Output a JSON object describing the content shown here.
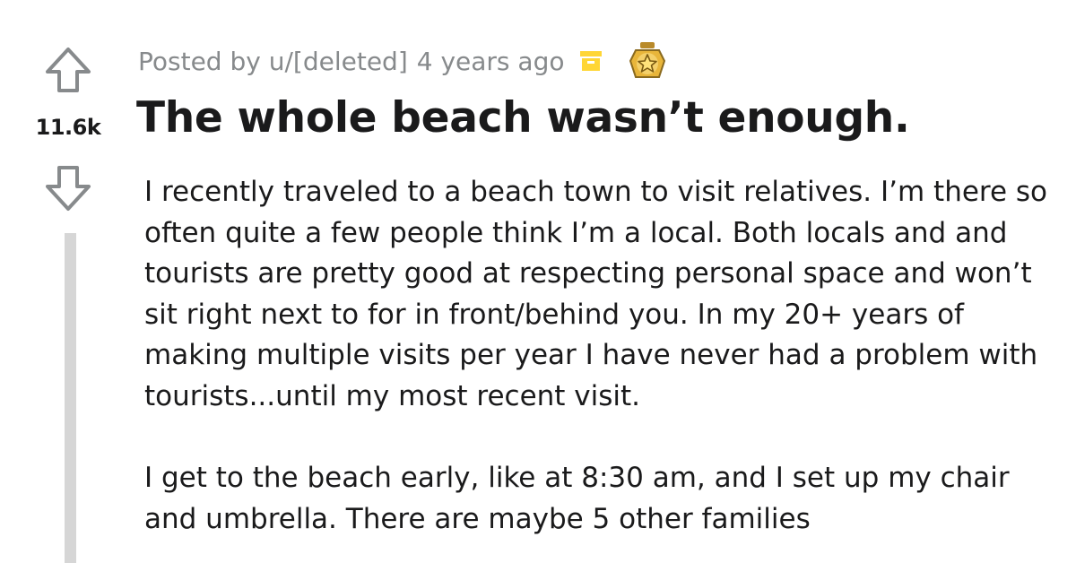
{
  "post": {
    "score": "11.6k",
    "author_line": "Posted by u/[deleted]",
    "age": "4 years ago",
    "title": "The whole beach wasn’t enough.",
    "paragraphs": [
      "I recently traveled to a beach town to visit relatives. I’m there so often quite a few people think I’m a local. Both locals and and tourists are pretty good at respecting personal space and won’t sit right next to for in front/behind you. In my 20+ years of making multiple visits per year I have never had a problem with tourists...until my most recent visit.",
      "I get to the beach early, like at 8:30 am, and I set up my chair and umbrella. There are maybe 5 other families"
    ]
  },
  "icons": {
    "upvote": "upvote-arrow-icon",
    "downvote": "downvote-arrow-icon",
    "archive": "archive-box-icon",
    "award": "gold-star-award-icon"
  },
  "colors": {
    "meta_text": "#878a8c",
    "archive_yellow": "#ffd635",
    "award_gold": "#e8b53a",
    "thread_line": "#d6d6d6"
  }
}
